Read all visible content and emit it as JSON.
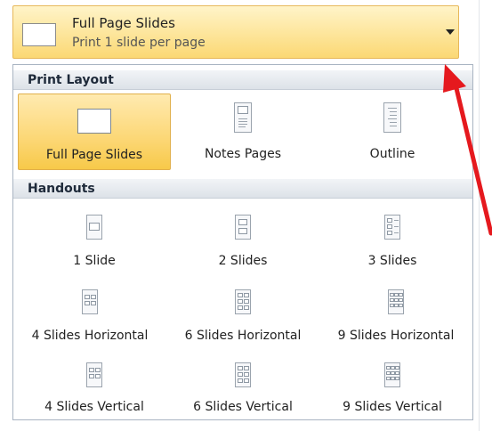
{
  "selector": {
    "title": "Full Page Slides",
    "subtitle": "Print 1 slide per page"
  },
  "sections": {
    "print_layout": "Print Layout",
    "handouts": "Handouts"
  },
  "print_layout_items": [
    {
      "label": "Full Page Slides",
      "selected": true
    },
    {
      "label": "Notes Pages",
      "selected": false
    },
    {
      "label": "Outline",
      "selected": false
    }
  ],
  "handout_items": [
    {
      "label": "1 Slide"
    },
    {
      "label": "2 Slides"
    },
    {
      "label": "3 Slides"
    },
    {
      "label": "4 Slides Horizontal"
    },
    {
      "label": "6 Slides Horizontal"
    },
    {
      "label": "9 Slides Horizontal"
    },
    {
      "label": "4 Slides Vertical"
    },
    {
      "label": "6 Slides Vertical"
    },
    {
      "label": "9 Slides Vertical"
    }
  ],
  "colors": {
    "selection_fill": "#fcd775",
    "annotation_arrow": "#e5191e"
  }
}
